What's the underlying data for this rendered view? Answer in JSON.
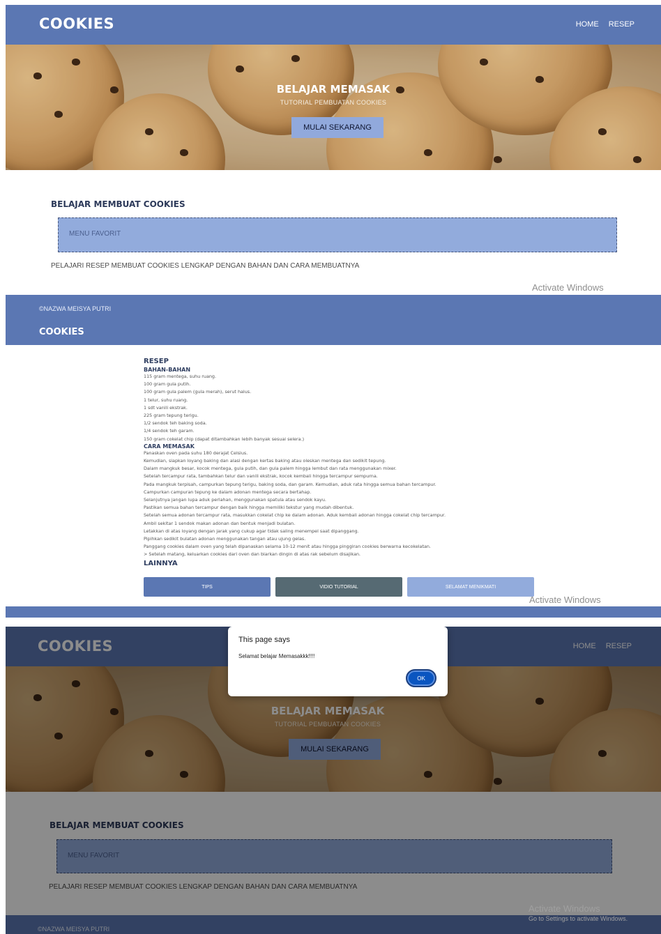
{
  "home": {
    "brand": "COOKIES",
    "nav": [
      "HOME",
      "RESEP"
    ],
    "hero_title": "BELAJAR MEMASAK",
    "hero_subtitle": "TUTORIAL PEMBUATAN COOKIES",
    "hero_button": "MULAI SEKARANG",
    "section_title": "BELAJAR MEMBUAT COOKIES",
    "menu_box": "MENU FAVORIT",
    "description": "PELAJARI RESEP MEMBUAT COOKIES LENGKAP DENGAN BAHAN DAN CARA MEMBUATNYA",
    "footer_copyright": "©NAZWA MEISYA PUTRI"
  },
  "watermark": {
    "line1": "Activate Windows",
    "line2": "Go to Settings to activate Windows."
  },
  "recipe_page": {
    "brand": "COOKIES",
    "title": "RESEP",
    "ingredients_heading": "BAHAN-BAHAN",
    "ingredients": [
      "115 gram mentega, suhu ruang.",
      "100 gram gula putih.",
      "100 gram gula palem (gula merah), serut halus.",
      "1 telur, suhu ruang.",
      "1 sdt vanili ekstrak.",
      "225 gram tepung terigu.",
      "1/2 sendok teh baking soda.",
      "1/4 sendok teh garam.",
      "150 gram cokelat chip (dapat ditambahkan lebih banyak sesuai selera.)"
    ],
    "method_heading": "CARA MEMASAK",
    "steps": [
      "Panaskan oven pada suhu 180 derajat Celsius.",
      "Kemudian, siapkan loyang baking dan alasi dengan kertas baking atau oleskan mentega dan sedikit tepung.",
      "Dalam mangkuk besar, kocok mentega, gula putih, dan gula palem hingga lembut dan rata menggunakan mixer.",
      "Setelah tercampur rata, tambahkan telur dan vanili ekstrak, kocok kembali hingga tercampur sempurna.",
      "Pada mangkuk terpisah, campurkan tepung terigu, baking soda, dan garam. Kemudian, aduk rata hingga semua bahan tercampur.",
      "Campurkan campuran tepung ke dalam adonan mentega secara bertahap.",
      "Selanjutnya jangan lupa aduk perlahan, menggunakan spatula atau sendok kayu.",
      "Pastikan semua bahan tercampur dengan baik hingga memiliki tekstur yang mudah dibentuk.",
      "Setelah semua adonan tercampur rata, masukkan cokelat chip ke dalam adonan. Aduk kembali adonan hingga cokelat chip tercampur.",
      "Ambil sekitar 1 sendok makan adonan dan bentuk menjadi bulatan.",
      "Letakkan di atas loyang dengan jarak yang cukup agar tidak saling menempel saat dipanggang.",
      "Pipihkan sedikit bulatan adonan menggunakan tangan atau ujung gelas.",
      "Panggang cookies dalam oven yang telah dipanaskan selama 10-12 menit atau hingga pinggiran cookies berwarna kecokelatan.",
      "> Setelah matang, keluarkan cookies dari oven dan biarkan dingin di atas rak sebelum disajikan."
    ],
    "others_heading": "LAINNYA",
    "buttons": [
      "TIPS",
      "VIDIO TUTORIAL",
      "SELAMAT MENIKMATI"
    ]
  },
  "dialog": {
    "title": "This page says",
    "message": "Selamat belajar Memasakkk!!!!",
    "ok": "OK"
  },
  "colors": {
    "nav_blue": "#5b77b3",
    "light_blue": "#92abdc",
    "slate": "#566a73",
    "ok_blue": "#0a55c0"
  }
}
